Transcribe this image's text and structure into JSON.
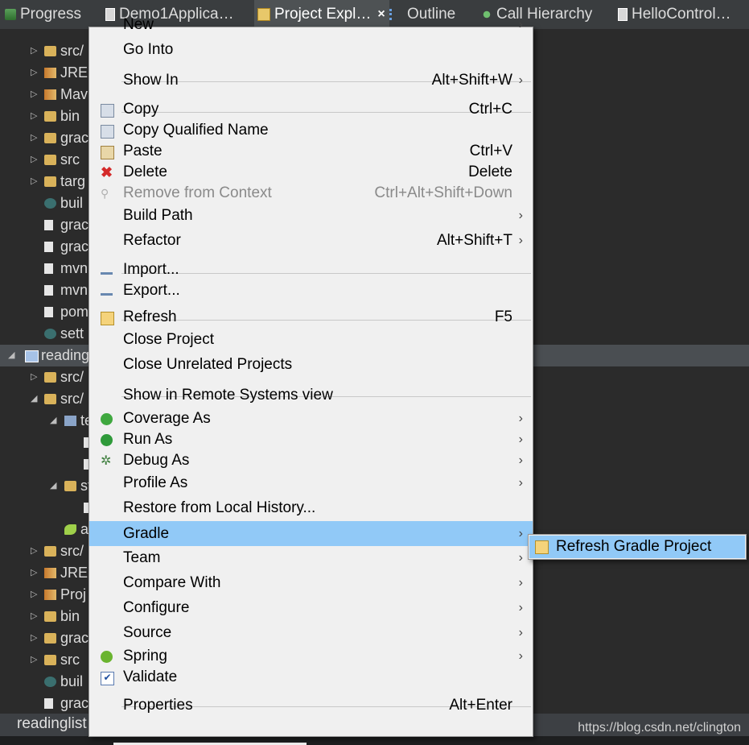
{
  "tabs": [
    {
      "label": "Progress",
      "icon": "progress-icon"
    },
    {
      "label": "Demo1Applica…",
      "icon": "java-file-icon"
    },
    {
      "label": "Project Expl…",
      "icon": "project-explorer-icon",
      "active": true
    },
    {
      "label": "Outline",
      "icon": "outline-icon"
    },
    {
      "label": "Call Hierarchy",
      "icon": "call-hierarchy-icon"
    },
    {
      "label": "HelloControl…",
      "icon": "java-file-icon"
    }
  ],
  "tab_close": "×",
  "tree": [
    {
      "label": "src/",
      "icon": "source-folder-icon"
    },
    {
      "label": "JRE",
      "icon": "library-icon"
    },
    {
      "label": "Mav",
      "icon": "library-icon"
    },
    {
      "label": "bin",
      "icon": "folder-icon"
    },
    {
      "label": "grac",
      "icon": "folder-icon"
    },
    {
      "label": "src",
      "icon": "folder-icon"
    },
    {
      "label": "targ",
      "icon": "folder-icon"
    },
    {
      "label": "buil",
      "icon": "gradle-file-icon"
    },
    {
      "label": "grac",
      "icon": "file-icon"
    },
    {
      "label": "grac",
      "icon": "file-icon"
    },
    {
      "label": "mvn",
      "icon": "file-icon"
    },
    {
      "label": "mvn",
      "icon": "file-icon"
    },
    {
      "label": "pom",
      "icon": "maven-file-icon"
    },
    {
      "label": "sett",
      "icon": "gradle-file-icon"
    },
    {
      "label": "reading",
      "icon": "project-icon"
    },
    {
      "label": "src/",
      "icon": "source-folder-icon"
    },
    {
      "label": "src/",
      "icon": "source-folder-icon"
    },
    {
      "label": "te",
      "icon": "package-icon"
    },
    {
      "label": "",
      "icon": "file-icon"
    },
    {
      "label": "",
      "icon": "file-icon"
    },
    {
      "label": "st",
      "icon": "folder-icon"
    },
    {
      "label": "",
      "icon": "file-icon"
    },
    {
      "label": "a",
      "icon": "spring-file-icon"
    },
    {
      "label": "src/",
      "icon": "source-folder-icon"
    },
    {
      "label": "JRE",
      "icon": "library-icon"
    },
    {
      "label": "Proj",
      "icon": "library-icon"
    },
    {
      "label": "bin",
      "icon": "folder-icon"
    },
    {
      "label": "grac",
      "icon": "folder-icon"
    },
    {
      "label": "src",
      "icon": "folder-icon"
    },
    {
      "label": "buil",
      "icon": "gradle-file-icon"
    },
    {
      "label": "grac",
      "icon": "file-icon"
    }
  ],
  "status_project": "readinglist",
  "watermark": "https://blog.csdn.net/clington",
  "menu": {
    "items": [
      {
        "label": "New",
        "accel": "",
        "submenu": true,
        "icon": ""
      },
      {
        "label": "Go Into",
        "accel": "",
        "submenu": false,
        "icon": ""
      },
      {
        "label": "Show In",
        "accel": "Alt+Shift+W",
        "submenu": true,
        "icon": ""
      },
      {
        "label": "Copy",
        "accel": "Ctrl+C",
        "submenu": false,
        "icon": "copy-icon"
      },
      {
        "label": "Copy Qualified Name",
        "accel": "",
        "submenu": false,
        "icon": "copy-qualified-icon"
      },
      {
        "label": "Paste",
        "accel": "Ctrl+V",
        "submenu": false,
        "icon": "paste-icon"
      },
      {
        "label": "Delete",
        "accel": "Delete",
        "submenu": false,
        "icon": "delete-icon"
      },
      {
        "label": "Remove from Context",
        "accel": "Ctrl+Alt+Shift+Down",
        "submenu": false,
        "icon": "remove-context-icon",
        "disabled": true
      },
      {
        "label": "Build Path",
        "accel": "",
        "submenu": true,
        "icon": ""
      },
      {
        "label": "Refactor",
        "accel": "Alt+Shift+T",
        "submenu": true,
        "icon": ""
      },
      {
        "label": "Import...",
        "accel": "",
        "submenu": false,
        "icon": "import-icon"
      },
      {
        "label": "Export...",
        "accel": "",
        "submenu": false,
        "icon": "export-icon"
      },
      {
        "label": "Refresh",
        "accel": "F5",
        "submenu": false,
        "icon": "refresh-icon"
      },
      {
        "label": "Close Project",
        "accel": "",
        "submenu": false,
        "icon": ""
      },
      {
        "label": "Close Unrelated Projects",
        "accel": "",
        "submenu": false,
        "icon": ""
      },
      {
        "label": "Show in Remote Systems view",
        "accel": "",
        "submenu": false,
        "icon": ""
      },
      {
        "label": "Coverage As",
        "accel": "",
        "submenu": true,
        "icon": "coverage-icon"
      },
      {
        "label": "Run As",
        "accel": "",
        "submenu": true,
        "icon": "run-icon"
      },
      {
        "label": "Debug As",
        "accel": "",
        "submenu": true,
        "icon": "debug-icon"
      },
      {
        "label": "Profile As",
        "accel": "",
        "submenu": true,
        "icon": ""
      },
      {
        "label": "Restore from Local History...",
        "accel": "",
        "submenu": false,
        "icon": ""
      },
      {
        "label": "Gradle",
        "accel": "",
        "submenu": true,
        "icon": "",
        "highlighted": true
      },
      {
        "label": "Team",
        "accel": "",
        "submenu": true,
        "icon": ""
      },
      {
        "label": "Compare With",
        "accel": "",
        "submenu": true,
        "icon": ""
      },
      {
        "label": "Configure",
        "accel": "",
        "submenu": true,
        "icon": ""
      },
      {
        "label": "Source",
        "accel": "",
        "submenu": true,
        "icon": ""
      },
      {
        "label": "Spring",
        "accel": "",
        "submenu": true,
        "icon": "spring-icon"
      },
      {
        "label": "Validate",
        "accel": "",
        "submenu": false,
        "icon": "validate-icon"
      },
      {
        "label": "Properties",
        "accel": "Alt+Enter",
        "submenu": false,
        "icon": ""
      }
    ],
    "submenu_arrow": "›"
  },
  "gradle_submenu": {
    "label": "Refresh Gradle Project",
    "icon": "refresh-gradle-icon"
  },
  "colors": {
    "menu_bg": "#f0f0f0",
    "highlight": "#91c9f7",
    "tree_bg": "#2b2b2b"
  }
}
